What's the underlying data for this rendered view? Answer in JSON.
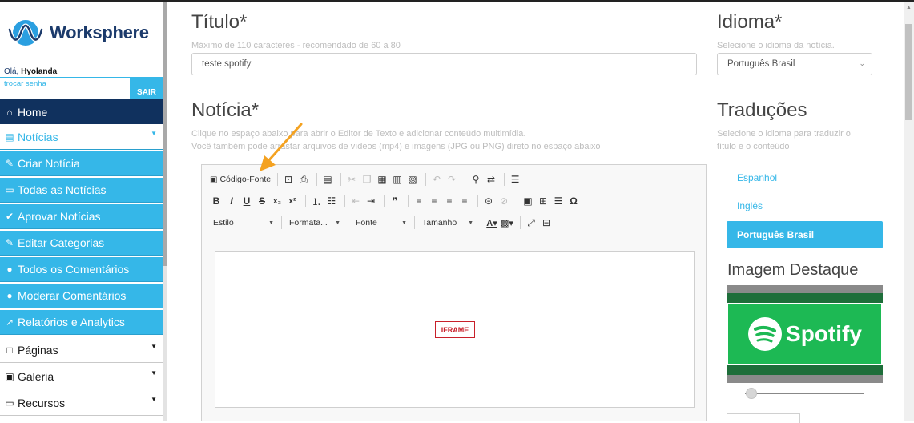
{
  "brand": {
    "name": "Worksphere"
  },
  "user": {
    "greeting": "Olá,",
    "name": "Hyolanda",
    "change_password": "trocar senha",
    "logout": "SAIR"
  },
  "sidebar": {
    "items": [
      {
        "icon": "home-icon",
        "glyph": "⌂",
        "label": "Home"
      },
      {
        "icon": "newspaper-icon",
        "glyph": "▤",
        "label": "Notícias"
      },
      {
        "icon": "pencil-icon",
        "glyph": "✎",
        "label": "Criar Notícia"
      },
      {
        "icon": "hdd-icon",
        "glyph": "▭",
        "label": "Todas as Notícias"
      },
      {
        "icon": "check-icon",
        "glyph": "✔",
        "label": "Aprovar Notícias"
      },
      {
        "icon": "pencil-icon",
        "glyph": "✎",
        "label": "Editar Categorias"
      },
      {
        "icon": "comment-icon",
        "glyph": "●",
        "label": "Todos os Comentários"
      },
      {
        "icon": "comment-icon",
        "glyph": "●",
        "label": "Moderar Comentários"
      },
      {
        "icon": "line-chart-icon",
        "glyph": "↗",
        "label": "Relatórios e Analytics"
      },
      {
        "icon": "window-icon",
        "glyph": "□",
        "label": "Páginas"
      },
      {
        "icon": "image-icon",
        "glyph": "▣",
        "label": "Galeria"
      },
      {
        "icon": "laptop-icon",
        "glyph": "▭",
        "label": "Recursos"
      }
    ]
  },
  "form": {
    "title": {
      "label": "Título*",
      "hint": "Máximo de 110 caracteres - recomendado de 60 a 80",
      "value": "teste spotify"
    },
    "language": {
      "label": "Idioma*",
      "hint": "Selecione o idioma da notícia.",
      "selected": "Português Brasil"
    },
    "news": {
      "label": "Notícia*",
      "hint_line1": "Clique no espaço abaixo para abrir o Editor de Texto e adicionar conteúdo multimídia.",
      "hint_line2": "Você também pode arrastar arquivos de vídeos (mp4) e imagens (JPG ou PNG) direto no espaço abaixo"
    },
    "translations": {
      "label": "Traduções",
      "hint_line1": "Selecione o idioma para traduzir o",
      "hint_line2": "título e o conteúdo",
      "languages": [
        "Espanhol",
        "Inglês",
        "Português Brasil"
      ],
      "active_index": 2
    },
    "featured_image": {
      "label": "Imagem Destaque",
      "image_text": "Spotify"
    }
  },
  "editor": {
    "source_button": "Código-Fonte",
    "combos": {
      "style": "Estilo",
      "format": "Formata...",
      "font": "Fonte",
      "size": "Tamanho"
    },
    "embedded_tag": "IFRAME"
  },
  "colors": {
    "accent": "#35b7e8",
    "nav_dark": "#10315e",
    "spotify_green": "#1db954",
    "arrow": "#f4a221"
  }
}
